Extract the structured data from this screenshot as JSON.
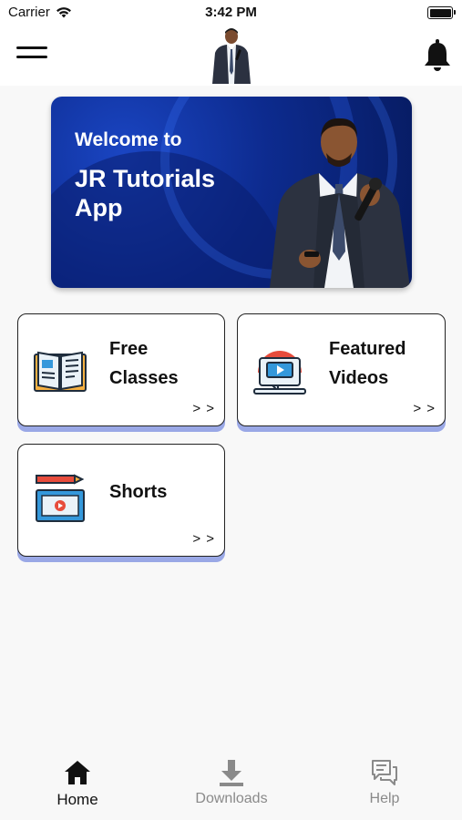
{
  "status_bar": {
    "carrier": "Carrier",
    "time": "3:42 PM"
  },
  "header": {
    "logo": "presenter-logo"
  },
  "banner": {
    "welcome": "Welcome to",
    "title": "JR Tutorials App"
  },
  "cards": [
    {
      "label": "Free\nClasses",
      "icon": "book-icon",
      "arrow": "> >"
    },
    {
      "label": "Featured\nVideos",
      "icon": "video-play-icon",
      "arrow": "> >"
    },
    {
      "label": "Shorts",
      "icon": "video-editor-icon",
      "arrow": "> >"
    }
  ],
  "bottom_nav": {
    "items": [
      {
        "label": "Home",
        "icon": "home-icon",
        "active": true
      },
      {
        "label": "Downloads",
        "icon": "download-icon",
        "active": false
      },
      {
        "label": "Help",
        "icon": "chat-icon",
        "active": false
      }
    ]
  },
  "colors": {
    "accent": "#1a45c2",
    "card_shadow": "#9aa8e6",
    "inactive": "#8a8a8a"
  }
}
